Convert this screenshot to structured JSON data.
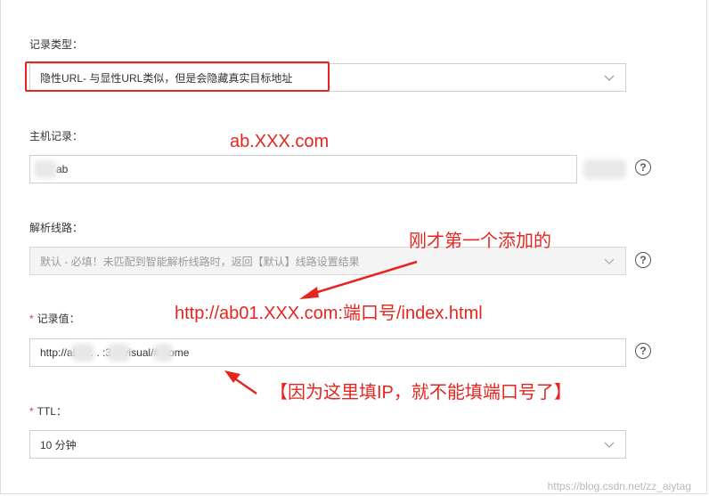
{
  "record_type": {
    "label": "记录类型：",
    "value": "隐性URL- 与显性URL类似，但是会隐藏真实目标地址"
  },
  "host_record": {
    "label": "主机记录：",
    "value": "ab"
  },
  "resolve_line": {
    "label": "解析线路：",
    "value": "默认 - 必填！未匹配到智能解析线路时，返回【默认】线路设置结果"
  },
  "record_value": {
    "label": "记录值：",
    "value": "http://ab01.  .  :3  2/visual/#/home"
  },
  "ttl": {
    "label": "TTL：",
    "value": "10 分钟"
  },
  "help_glyph": "?",
  "annotations": {
    "host_note": "ab.XXX.com",
    "line_note": "刚才第一个添加的",
    "value_note": "http://ab01.XXX.com:端口号/index.html",
    "warning_note": "【因为这里填IP，就不能填端口号了】"
  },
  "colors": {
    "annotation": "#e5251f",
    "required": "#e5393d",
    "border": "#cfcfcf"
  },
  "watermark": "https://blog.csdn.net/zz_aiytag"
}
